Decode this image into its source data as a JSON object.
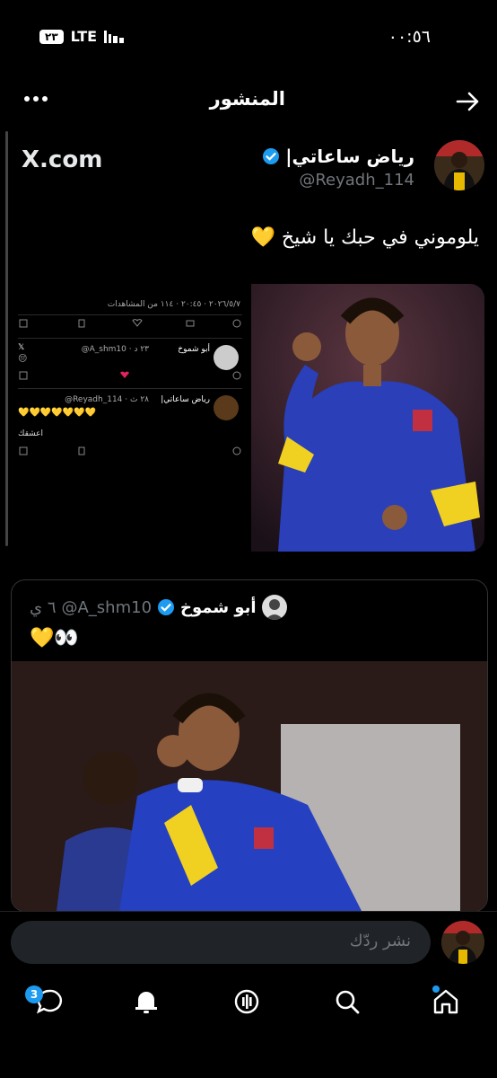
{
  "status": {
    "time": "٠٠:٥٦",
    "notification_count": "٢٣",
    "network": "LTE"
  },
  "header": {
    "title": "المنشور"
  },
  "post": {
    "author_name": "رياض ساعاتي|",
    "author_handle": "@Reyadh_114",
    "source_label": "X.com",
    "text": "يلوموني في حبك يا شيخ",
    "emoji": "💛",
    "embedded_screenshot": {
      "meta": "٢٠٢٦/٥/٧ · ٢٠:٤٥ · ١١٤ من المشاهدات",
      "reply1_name": "أبو شموخ",
      "reply1_handle": "@A_shm10 · ٢٣ د",
      "reply1_emoji": "😔",
      "reply2_name": "رياض ساعاتي|",
      "reply2_handle": "@Reyadh_114 · ٢٨ ث",
      "reply2_hearts": "💛💛💛💛💛💛💛",
      "reply3_text": "اعشقك"
    }
  },
  "quote": {
    "author_name": "أبو شموخ",
    "author_handle": "@A_shm10",
    "time": "٦ ي",
    "text": "💛👀"
  },
  "reply_bar": {
    "placeholder": "نشر ردّك"
  },
  "nav": {
    "messages_badge": "3"
  },
  "colors": {
    "accent": "#1d9bf0",
    "background": "#000000",
    "muted": "#71767b"
  }
}
